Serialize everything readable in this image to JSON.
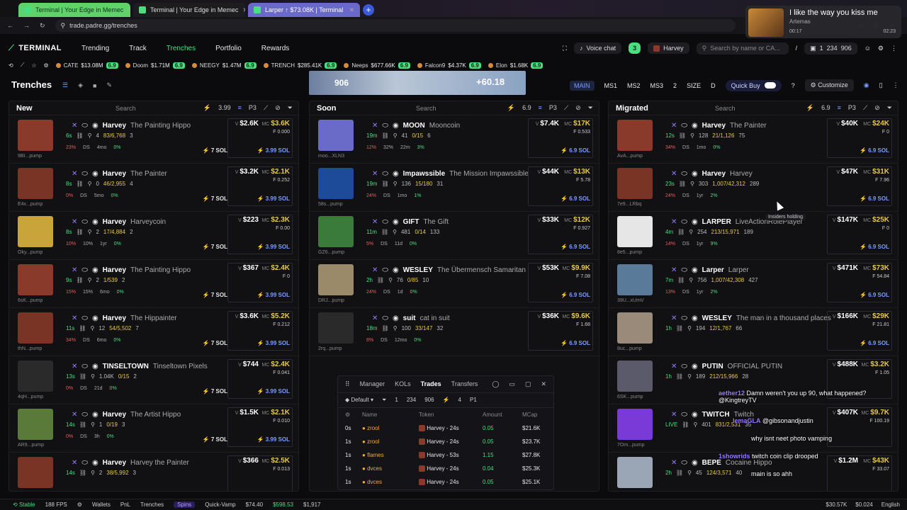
{
  "browser": {
    "tabs": [
      {
        "title": "Terminal | Your Edge in Memec"
      },
      {
        "title": "Terminal | Your Edge in Memec"
      },
      {
        "title": "Larper ↑ $73.08K | Terminal"
      }
    ],
    "url": "trade.padre.gg/trenches"
  },
  "media": {
    "title": "I like the way you kiss me",
    "artist": "Artemas",
    "elapsed": "00:17",
    "total": "02:23"
  },
  "nav": {
    "logo": "TERMINAL",
    "links": [
      "Trending",
      "Track",
      "Trenches",
      "Portfolio",
      "Rewards"
    ],
    "voice_chat": "Voice chat",
    "badge": "3",
    "user": "Harvey",
    "search_placeholder": "Search by name or CA...",
    "slash": "/",
    "counts": [
      "1",
      "234",
      "906"
    ]
  },
  "ticker": [
    {
      "name": "CATE",
      "value": "$13.08M",
      "chg": "6.9"
    },
    {
      "name": "Doom",
      "value": "$1.71M",
      "chg": "6.9"
    },
    {
      "name": "NEEGY",
      "value": "$1.47M",
      "chg": "6.9"
    },
    {
      "name": "TRENCH",
      "value": "$285.41K",
      "chg": "6.9"
    },
    {
      "name": "Neeps",
      "value": "$677.66K",
      "chg": "6.9"
    },
    {
      "name": "Falcon9",
      "value": "$4.37K",
      "chg": "6.9"
    },
    {
      "name": "Elon",
      "value": "$1.68K",
      "chg": "6.9"
    }
  ],
  "trenches": {
    "title": "Trenches",
    "banner_left": "906",
    "banner_right": "+60.18",
    "modes": [
      "MAIN",
      "MS1",
      "MS2",
      "MS3",
      "2",
      "SIZE",
      "D"
    ],
    "quick_buy": "Quick Buy",
    "customize": "Customize"
  },
  "columns": [
    {
      "title": "New",
      "search": "Search",
      "tools": [
        "3.99",
        "P3"
      ],
      "cards": [
        {
          "ticker": "Harvey",
          "name": "The Painting Hippo",
          "age": "6s",
          "holders": "4",
          "hl": "83/6,768",
          "extra": "3",
          "src": "9BI...pump",
          "s1": "23%",
          "s2": "DS",
          "s3": "4mo",
          "s4": "0%",
          "vol": "$2.6K",
          "mc": "$3.6K",
          "fee": "F 0.000",
          "sol": "7 SOL",
          "buy": "3.99 SOL",
          "color": "#8a3a2a"
        },
        {
          "ticker": "Harvey",
          "name": "The Painter",
          "age": "8s",
          "holders": "0",
          "hl": "46/2,955",
          "extra": "4",
          "src": "E4x...pump",
          "s1": "0%",
          "s2": "DS",
          "s3": "5mo",
          "s4": "0%",
          "vol": "$3.2K",
          "mc": "$2.1K",
          "fee": "F 0.252",
          "sol": "7 SOL",
          "buy": "3.99 SOL",
          "color": "#7a3426"
        },
        {
          "ticker": "Harvey",
          "name": "Harveycoin",
          "age": "8s",
          "holders": "2",
          "hl": "17/4,884",
          "extra": "2",
          "src": "Oky...pump",
          "s1": "10%",
          "s2": "10%",
          "s3": "1yr",
          "s4": "0%",
          "vol": "$223",
          "mc": "$2.3K",
          "fee": "F 0.00",
          "sol": "7 SOL",
          "buy": "3.99 SOL",
          "color": "#c9a43a"
        },
        {
          "ticker": "Harvey",
          "name": "The Painting Hippo",
          "age": "9s",
          "holders": "2",
          "hl": "1/539",
          "extra": "2",
          "src": "6sK...pump",
          "s1": "15%",
          "s2": "15%",
          "s3": "6mo",
          "s4": "0%",
          "vol": "$367",
          "mc": "$2.4K",
          "fee": "F 0",
          "sol": "7 SOL",
          "buy": "3.99 SOL",
          "color": "#8a3a2a"
        },
        {
          "ticker": "Harvey",
          "name": "The Hippainter",
          "age": "11s",
          "holders": "12",
          "hl": "54/5,502",
          "extra": "7",
          "src": "thN...pump",
          "s1": "34%",
          "s2": "DS",
          "s3": "6mo",
          "s4": "0%",
          "vol": "$3.6K",
          "mc": "$5.2K",
          "fee": "F 0.212",
          "sol": "7 SOL",
          "buy": "3.99 SOL",
          "color": "#7a3426"
        },
        {
          "ticker": "TINSELTOWN",
          "name": "Tinseltown Pixels",
          "age": "13s",
          "holders": "1.04K",
          "hl": "0/15",
          "extra": "2",
          "src": "4qH...pump",
          "s1": "0%",
          "s2": "DS",
          "s3": "21d",
          "s4": "0%",
          "vol": "$744",
          "mc": "$2.4K",
          "fee": "F 0.041",
          "sol": "7 SOL",
          "buy": "3.99 SOL",
          "color": "#2a2a2a"
        },
        {
          "ticker": "Harvey",
          "name": "The Artist Hippo",
          "age": "14s",
          "holders": "1",
          "hl": "0/19",
          "extra": "3",
          "src": "AR9...pump",
          "s1": "0%",
          "s2": "DS",
          "s3": "3h",
          "s4": "0%",
          "vol": "$1.5K",
          "mc": "$2.1K",
          "fee": "F 0.010",
          "sol": "7 SOL",
          "buy": "3.99 SOL",
          "color": "#5a7a3a"
        },
        {
          "ticker": "Harvey",
          "name": "Harvey the Painter",
          "age": "14s",
          "holders": "2",
          "hl": "38/5,992",
          "extra": "3",
          "src": "",
          "s1": "",
          "s2": "",
          "s3": "",
          "s4": "",
          "vol": "$366",
          "mc": "$2.5K",
          "fee": "F 0.013",
          "sol": "",
          "buy": "",
          "color": "#7a3426"
        }
      ]
    },
    {
      "title": "Soon",
      "search": "Search",
      "tools": [
        "6.9",
        "P3"
      ],
      "cards": [
        {
          "ticker": "MOON",
          "name": "Mooncoin",
          "age": "19m",
          "holders": "41",
          "hl": "0/15",
          "extra": "6",
          "src": "moo...XLN3",
          "s1": "12%",
          "s2": "32%",
          "s3": "22m",
          "s4": "3%",
          "vol": "$7.4K",
          "mc": "$17K",
          "fee": "F 0.533",
          "sol": "",
          "buy": "6.9 SOL",
          "color": "#6a6ac8"
        },
        {
          "ticker": "Impawssible",
          "name": "The Mission Impawssible",
          "age": "19m",
          "holders": "136",
          "hl": "15/180",
          "extra": "31",
          "src": "58s...pump",
          "s1": "24%",
          "s2": "DS",
          "s3": "1mo",
          "s4": "1%",
          "vol": "$44K",
          "mc": "$13K",
          "fee": "F 5.78",
          "sol": "",
          "buy": "6.9 SOL",
          "color": "#1e4a9a"
        },
        {
          "ticker": "GIFT",
          "name": "The Gift",
          "age": "11m",
          "holders": "481",
          "hl": "0/14",
          "extra": "133",
          "src": "GZ6...pump",
          "s1": "5%",
          "s2": "DS",
          "s3": "11d",
          "s4": "0%",
          "vol": "$33K",
          "mc": "$12K",
          "fee": "F 0.927",
          "sol": "",
          "buy": "6.9 SOL",
          "color": "#3a7a3a"
        },
        {
          "ticker": "WESLEY",
          "name": "The Übermensch Samaritan",
          "age": "2h",
          "holders": "76",
          "hl": "0/85",
          "extra": "10",
          "src": "DRJ...pump",
          "s1": "24%",
          "s2": "DS",
          "s3": "1d",
          "s4": "0%",
          "vol": "$53K",
          "mc": "$9.9K",
          "fee": "F 7.08",
          "sol": "",
          "buy": "6.9 SOL",
          "color": "#9a8a6a"
        },
        {
          "ticker": "suit",
          "name": "cat in suit",
          "age": "18m",
          "holders": "100",
          "hl": "33/147",
          "extra": "32",
          "src": "2rq...pump",
          "s1": "8%",
          "s2": "DS",
          "s3": "12mo",
          "s4": "0%",
          "vol": "$36K",
          "mc": "$9.6K",
          "fee": "F 1.68",
          "sol": "",
          "buy": "6.9 SOL",
          "color": "#2a2a2a"
        }
      ]
    },
    {
      "title": "Migrated",
      "search": "Search",
      "tools": [
        "6.9",
        "P3"
      ],
      "cards": [
        {
          "ticker": "Harvey",
          "name": "The Painter",
          "age": "12s",
          "holders": "128",
          "hl": "21/1,126",
          "extra": "75",
          "src": "AvA...pump",
          "s1": "34%",
          "s2": "DS",
          "s3": "1mo",
          "s4": "0%",
          "vol": "$40K",
          "mc": "$24K",
          "fee": "F 0",
          "sol": "",
          "buy": "6.9 SOL",
          "color": "#8a3a2a"
        },
        {
          "ticker": "Harvey",
          "name": "Harvey",
          "age": "23s",
          "holders": "303",
          "hl": "1,007/42,312",
          "extra": "289",
          "src": "7e9...LRbq",
          "s1": "24%",
          "s2": "DS",
          "s3": "1yr",
          "s4": "2%",
          "vol": "$47K",
          "mc": "$31K",
          "fee": "F 7.96",
          "sol": "",
          "buy": "6.9 SOL",
          "color": "#7a3426"
        },
        {
          "ticker": "LARPER",
          "name": "LiveActionRolePlayer",
          "age": "4m",
          "holders": "254",
          "hl": "213/15,971",
          "extra": "189",
          "src": "8e5...pump",
          "s1": "14%",
          "s2": "DS",
          "s3": "1yr",
          "s4": "9%",
          "vol": "$147K",
          "mc": "$25K",
          "fee": "F 0",
          "sol": "",
          "buy": "6.9 SOL",
          "color": "#e6e6e6"
        },
        {
          "ticker": "Larper",
          "name": "Larper",
          "age": "7m",
          "holders": "756",
          "hl": "1,007/42,308",
          "extra": "427",
          "src": "39U...xUmV",
          "s1": "13%",
          "s2": "DS",
          "s3": "1yr",
          "s4": "2%",
          "vol": "$471K",
          "mc": "$73K",
          "fee": "F 54.84",
          "sol": "",
          "buy": "6.9 SOL",
          "color": "#5a7a9a"
        },
        {
          "ticker": "WESLEY",
          "name": "The man in a thousand places",
          "age": "1h",
          "holders": "194",
          "hl": "12/1,767",
          "extra": "66",
          "src": "8uc...pump",
          "s1": "",
          "s2": "",
          "s3": "",
          "s4": "",
          "vol": "$166K",
          "mc": "$29K",
          "fee": "F 21.81",
          "sol": "",
          "buy": "6.9 SOL",
          "color": "#9a8a7a"
        },
        {
          "ticker": "PUTIN",
          "name": "OFFICIAL PUTIN",
          "age": "1h",
          "holders": "189",
          "hl": "212/15,966",
          "extra": "28",
          "src": "6SK...pump",
          "s1": "",
          "s2": "",
          "s3": "",
          "s4": "",
          "vol": "$488K",
          "mc": "$3.2K",
          "fee": "F 1.05",
          "sol": "",
          "buy": "",
          "color": "#5a5a6a"
        },
        {
          "ticker": "TWITCH",
          "name": "Twitch",
          "age": "LIVE",
          "holders": "401",
          "hl": "831/2,531",
          "extra": "35",
          "src": "7Om...pump",
          "s1": "",
          "s2": "",
          "s3": "",
          "s4": "",
          "vol": "$407K",
          "mc": "$9.7K",
          "fee": "F 100.19",
          "sol": "",
          "buy": "",
          "color": "#7a3ad8"
        },
        {
          "ticker": "BEPE",
          "name": "Cocaine Hippo",
          "age": "2h",
          "holders": "45",
          "hl": "124/3,571",
          "extra": "40",
          "src": "",
          "s1": "",
          "s2": "",
          "s3": "",
          "s4": "",
          "vol": "$1.2M",
          "mc": "$43K",
          "fee": "F 33.07",
          "sol": "",
          "buy": "",
          "color": "#9aa6b6"
        }
      ]
    }
  ],
  "trades_panel": {
    "tabs": [
      "Manager",
      "KOLs",
      "Trades",
      "Transfers"
    ],
    "preset": "Default",
    "counts": [
      "1",
      "234",
      "906",
      "4",
      "P1"
    ],
    "headers": [
      "Name",
      "Token",
      "Amount",
      "MCap"
    ],
    "rows": [
      {
        "t": "0s",
        "name": "zrool",
        "token": "Harvey - 24s",
        "amount": "0.05",
        "mcap": "$21.6K"
      },
      {
        "t": "1s",
        "name": "zrool",
        "token": "Harvey - 24s",
        "amount": "0.05",
        "mcap": "$23.7K"
      },
      {
        "t": "1s",
        "name": "flames",
        "token": "Harvey - 53s",
        "amount": "1.15",
        "mcap": "$27.8K"
      },
      {
        "t": "1s",
        "name": "dvces",
        "token": "Harvey - 24s",
        "amount": "0.04",
        "mcap": "$25.3K"
      },
      {
        "t": "1s",
        "name": "dvces",
        "token": "Harvey - 24s",
        "amount": "0.05",
        "mcap": "$25.1K"
      }
    ]
  },
  "chat": [
    {
      "user": "aether12",
      "msg": "Damn weren't you up 90, what happened?",
      "handle": "@KingtreyTV"
    },
    {
      "user": "lemaGLA",
      "msg": "@gibsonandjustin",
      "handle": ""
    },
    {
      "user": "",
      "msg": "why isnt neet photo vamping",
      "handle": ""
    },
    {
      "user": "1showrids",
      "msg": "twitch coin clip drooped",
      "handle": ""
    },
    {
      "user": "",
      "msg": "main is so ahh",
      "handle": ""
    }
  ],
  "tooltip": "Insiders holding",
  "status": {
    "stable": "Stable",
    "fps": "188 FPS",
    "items": [
      "Wallets",
      "PnL",
      "Trenches"
    ],
    "spins": "Spins",
    "quick": "Quick-Vamp",
    "prices": [
      "$74.40",
      "$598.53",
      "$1,917"
    ],
    "right": [
      "$30.57K",
      "$0.024",
      "English"
    ]
  },
  "colors": {
    "accent": "#4ade80",
    "mc": "#e6c84a",
    "blue": "#7a9cff",
    "red": "#f05a5a"
  }
}
